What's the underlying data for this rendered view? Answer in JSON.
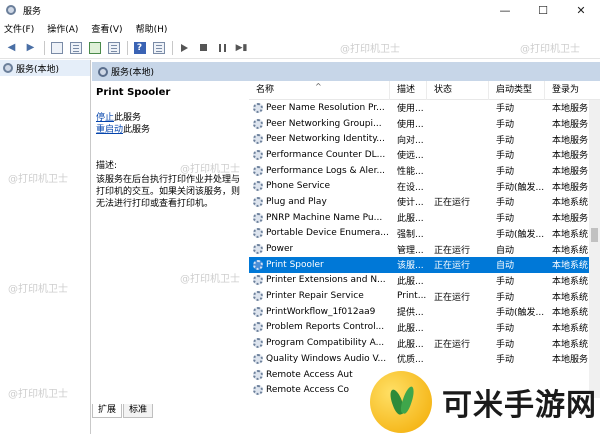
{
  "window": {
    "title": "服务",
    "minimize": "—",
    "maximize": "☐",
    "close": "✕"
  },
  "menu": [
    {
      "label": "文件(F)"
    },
    {
      "label": "操作(A)"
    },
    {
      "label": "查看(V)"
    },
    {
      "label": "帮助(H)"
    }
  ],
  "tree": {
    "root": "服务(本地)"
  },
  "right_header": "服务(本地)",
  "detail": {
    "service_name": "Print Spooler",
    "stop_link": "停止",
    "stop_suffix": "此服务",
    "restart_link": "重启动",
    "restart_suffix": "此服务",
    "desc_label": "描述:",
    "desc_text": "该服务在后台执行打印作业并处理与打印机的交互。如果关闭该服务，则无法进行打印或查看打印机。"
  },
  "table": {
    "columns": {
      "name": "名称",
      "desc": "描述",
      "status": "状态",
      "startup": "启动类型",
      "logon": "登录为"
    },
    "sort_arrow": "^",
    "rows": [
      {
        "name": "Peer Name Resolution Pr...",
        "desc": "使用...",
        "status": "",
        "startup": "手动",
        "logon": "本地服务"
      },
      {
        "name": "Peer Networking Groupi...",
        "desc": "使用...",
        "status": "",
        "startup": "手动",
        "logon": "本地服务"
      },
      {
        "name": "Peer Networking Identity...",
        "desc": "向对...",
        "status": "",
        "startup": "手动",
        "logon": "本地服务"
      },
      {
        "name": "Performance Counter DL...",
        "desc": "使远...",
        "status": "",
        "startup": "手动",
        "logon": "本地服务"
      },
      {
        "name": "Performance Logs & Aler...",
        "desc": "性能...",
        "status": "",
        "startup": "手动",
        "logon": "本地服务"
      },
      {
        "name": "Phone Service",
        "desc": "在设...",
        "status": "",
        "startup": "手动(触发...",
        "logon": "本地服务"
      },
      {
        "name": "Plug and Play",
        "desc": "使计...",
        "status": "正在运行",
        "startup": "手动",
        "logon": "本地系统"
      },
      {
        "name": "PNRP Machine Name Pu...",
        "desc": "此服...",
        "status": "",
        "startup": "手动",
        "logon": "本地服务"
      },
      {
        "name": "Portable Device Enumera...",
        "desc": "强制...",
        "status": "",
        "startup": "手动(触发...",
        "logon": "本地系统"
      },
      {
        "name": "Power",
        "desc": "管理...",
        "status": "正在运行",
        "startup": "自动",
        "logon": "本地系统"
      },
      {
        "name": "Print Spooler",
        "desc": "该服...",
        "status": "正在运行",
        "startup": "自动",
        "logon": "本地系统",
        "selected": true
      },
      {
        "name": "Printer Extensions and N...",
        "desc": "此服...",
        "status": "",
        "startup": "手动",
        "logon": "本地系统"
      },
      {
        "name": "Printer Repair Service",
        "desc": "Print...",
        "status": "正在运行",
        "startup": "手动",
        "logon": "本地系统"
      },
      {
        "name": "PrintWorkflow_1f012aa9",
        "desc": "提供...",
        "status": "",
        "startup": "手动(触发...",
        "logon": "本地系统"
      },
      {
        "name": "Problem Reports Control...",
        "desc": "此服...",
        "status": "",
        "startup": "手动",
        "logon": "本地系统"
      },
      {
        "name": "Program Compatibility A...",
        "desc": "此服...",
        "status": "正在运行",
        "startup": "手动",
        "logon": "本地系统"
      },
      {
        "name": "Quality Windows Audio V...",
        "desc": "优质...",
        "status": "",
        "startup": "手动",
        "logon": "本地服务"
      },
      {
        "name": "Remote Access Aut",
        "desc": "",
        "status": "",
        "startup": "",
        "logon": ""
      },
      {
        "name": "Remote Access Co",
        "desc": "",
        "status": "",
        "startup": "",
        "logon": ""
      }
    ]
  },
  "tabs": [
    {
      "label": "扩展"
    },
    {
      "label": "标准"
    }
  ],
  "watermark": "@打印机卫士",
  "brand": {
    "text": "可米手游网"
  }
}
